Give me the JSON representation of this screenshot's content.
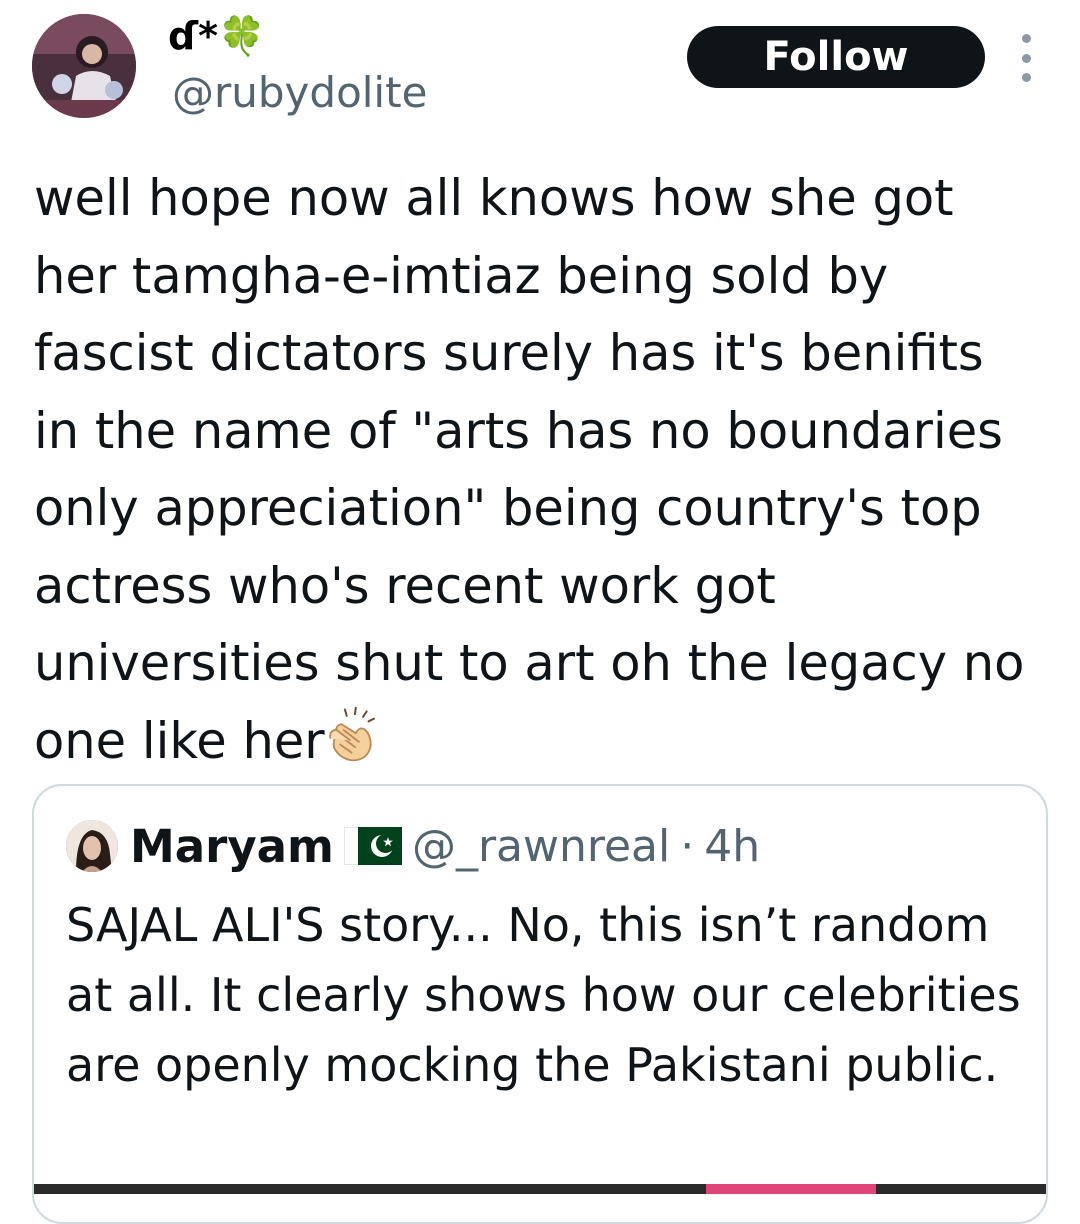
{
  "author": {
    "display_name": "ɗ*🍀",
    "handle": "@rubydolite"
  },
  "follow_label": "Follow",
  "tweet": {
    "text": "well hope now all knows how she got her tamgha-e-imtiaz being sold by fascist dictators surely has it's benifits in the name of \"arts has no boundaries only appreciation\" being country's top actress who's recent work got universities shut to art oh the legacy no one like her",
    "emoji": "clapping-hands"
  },
  "quoted": {
    "name": "Maryam",
    "flag": "pakistan-flag",
    "handle": "@_rawnreal",
    "separator": "·",
    "time": "4h",
    "text": "SAJAL ALI'S story... No, this isn’t random at all. It clearly shows how our celebrities are openly mocking the Pakistani public."
  },
  "colors": {
    "text": "#0f1419",
    "secondary": "#536471",
    "button_bg": "#0f1419",
    "border": "#cfd9de"
  }
}
